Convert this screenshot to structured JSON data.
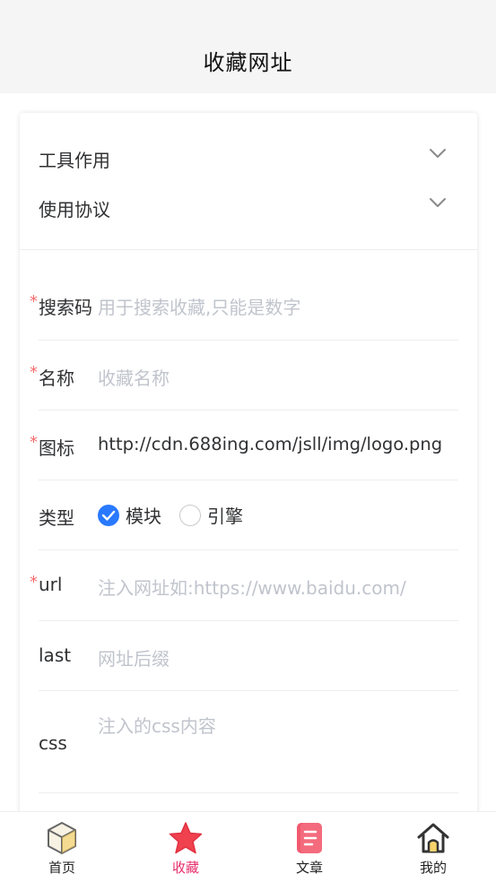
{
  "header": {
    "title": "收藏网址"
  },
  "collapse": [
    {
      "label": "工具作用"
    },
    {
      "label": "使用协议"
    }
  ],
  "form": {
    "search_code": {
      "label": "搜索码",
      "placeholder": "用于搜索收藏,只能是数字",
      "required": true
    },
    "name": {
      "label": "名称",
      "placeholder": "收藏名称",
      "required": true
    },
    "icon": {
      "label": "图标",
      "value": "http://cdn.688ing.com/jsll/img/logo.png",
      "required": true
    },
    "type": {
      "label": "类型",
      "options": [
        "模块",
        "引擎"
      ],
      "selected": "模块"
    },
    "url": {
      "label": "url",
      "placeholder": "注入网址如:https://www.baidu.com/",
      "required": true
    },
    "last": {
      "label": "last",
      "placeholder": "网址后缀"
    },
    "css": {
      "label": "css",
      "placeholder": "注入的css内容"
    }
  },
  "tabbar": {
    "items": [
      {
        "label": "首页",
        "icon": "cube-icon",
        "active": false
      },
      {
        "label": "收藏",
        "icon": "star-icon",
        "active": true
      },
      {
        "label": "文章",
        "icon": "article-icon",
        "active": false
      },
      {
        "label": "我的",
        "icon": "home-icon",
        "active": false
      }
    ],
    "active_color": "#e62e6b"
  },
  "colors": {
    "accent": "#2979ff",
    "required": "#f56c6c",
    "placeholder": "#c0c4cc"
  }
}
